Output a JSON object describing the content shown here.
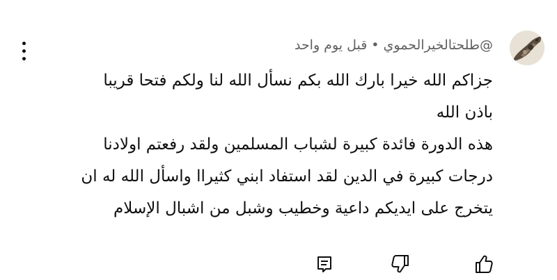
{
  "comment": {
    "author": "@طلحتالخيرالحموي",
    "separator": "•",
    "time": "قبل يوم واحد",
    "lines": [
      "جزاكم الله خيرا بارك الله بكم نسأل الله لنا ولكم فتحا قريبا",
      "باذن الله",
      "هذه الدورة فائدة كبيرة لشباب المسلمين ولقد رفعتم اولادنا",
      "درجات كبيرة في الدين لقد استفاد ابني كثيراا واسأل الله له ان",
      "يتخرج على ايديكم داعية وخطيب وشبل من اشبال الإسلام"
    ]
  },
  "icons": {
    "menu": "more-vert-icon",
    "like": "thumb-up-icon",
    "dislike": "thumb-down-icon",
    "reply": "reply-comment-icon"
  }
}
